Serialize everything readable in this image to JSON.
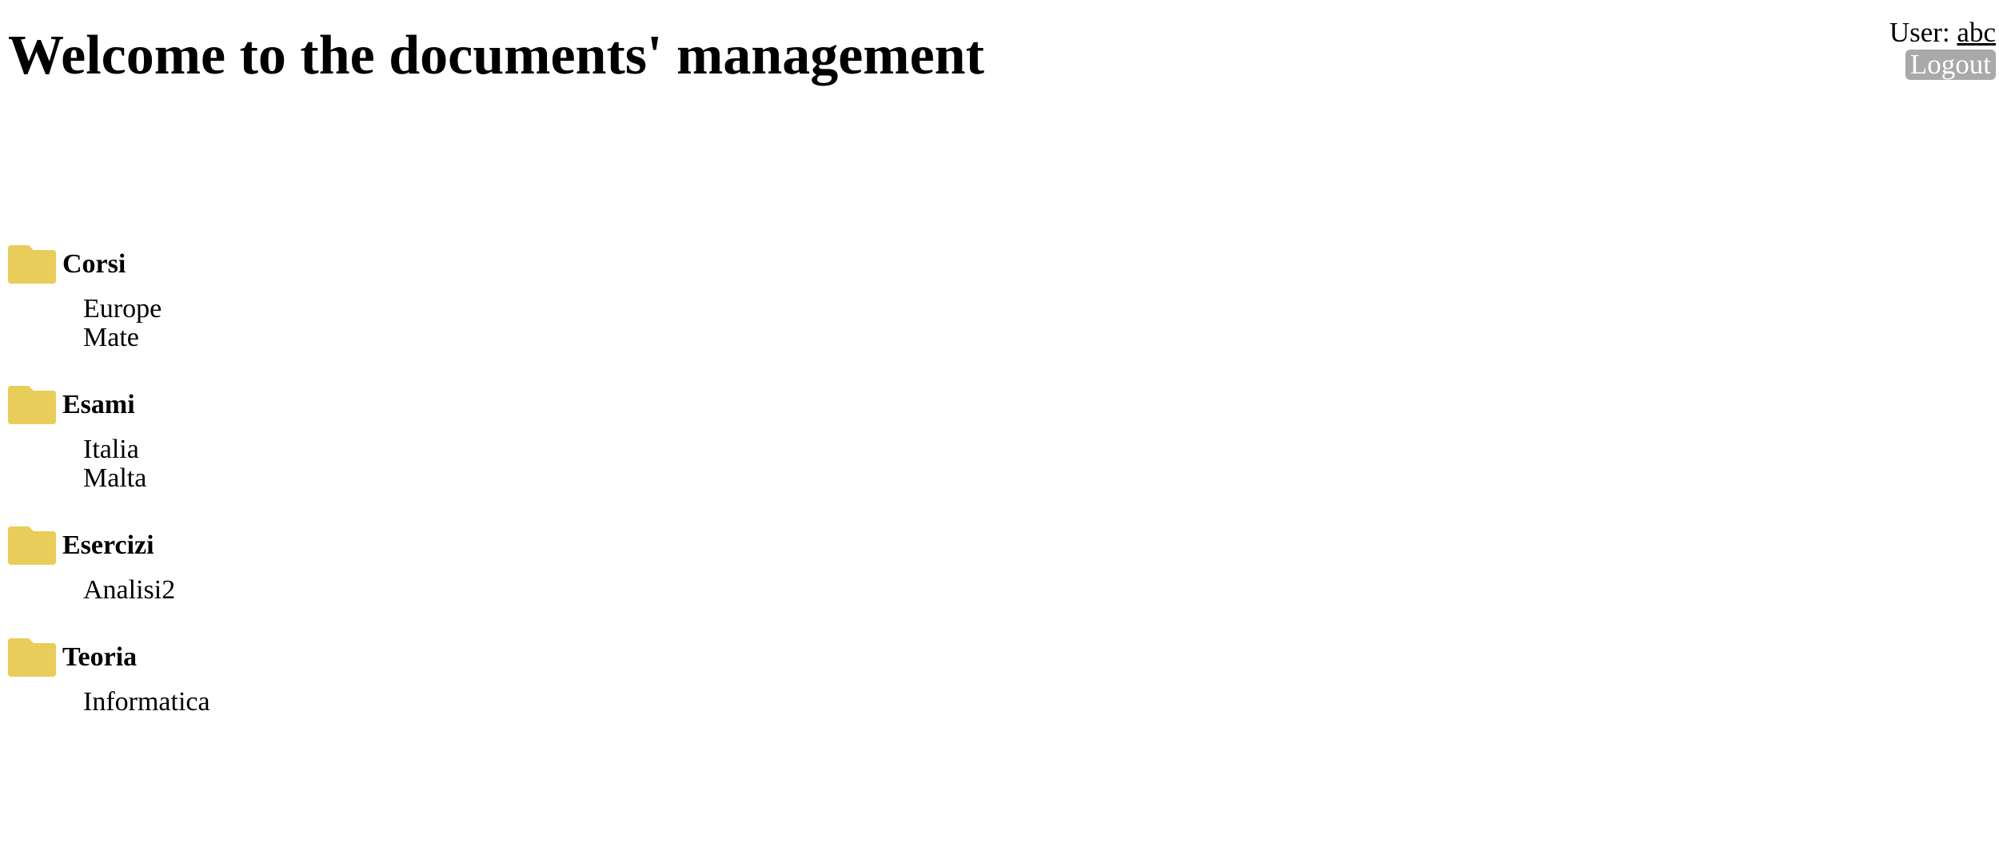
{
  "header": {
    "title": "Welcome to the documents' management",
    "user_prefix": "User:",
    "username": "abc",
    "logout_label": "Logout"
  },
  "colors": {
    "folder": "#e9cd5a",
    "logout_bg": "#a9a9a9"
  },
  "folders": [
    {
      "name": "Corsi",
      "icon": "folder-icon",
      "subfolders": [
        "Europe",
        "Mate"
      ]
    },
    {
      "name": "Esami",
      "icon": "folder-icon",
      "subfolders": [
        "Italia",
        "Malta"
      ]
    },
    {
      "name": "Esercizi",
      "icon": "folder-icon",
      "subfolders": [
        "Analisi2"
      ]
    },
    {
      "name": "Teoria",
      "icon": "folder-icon",
      "subfolders": [
        "Informatica"
      ]
    }
  ]
}
